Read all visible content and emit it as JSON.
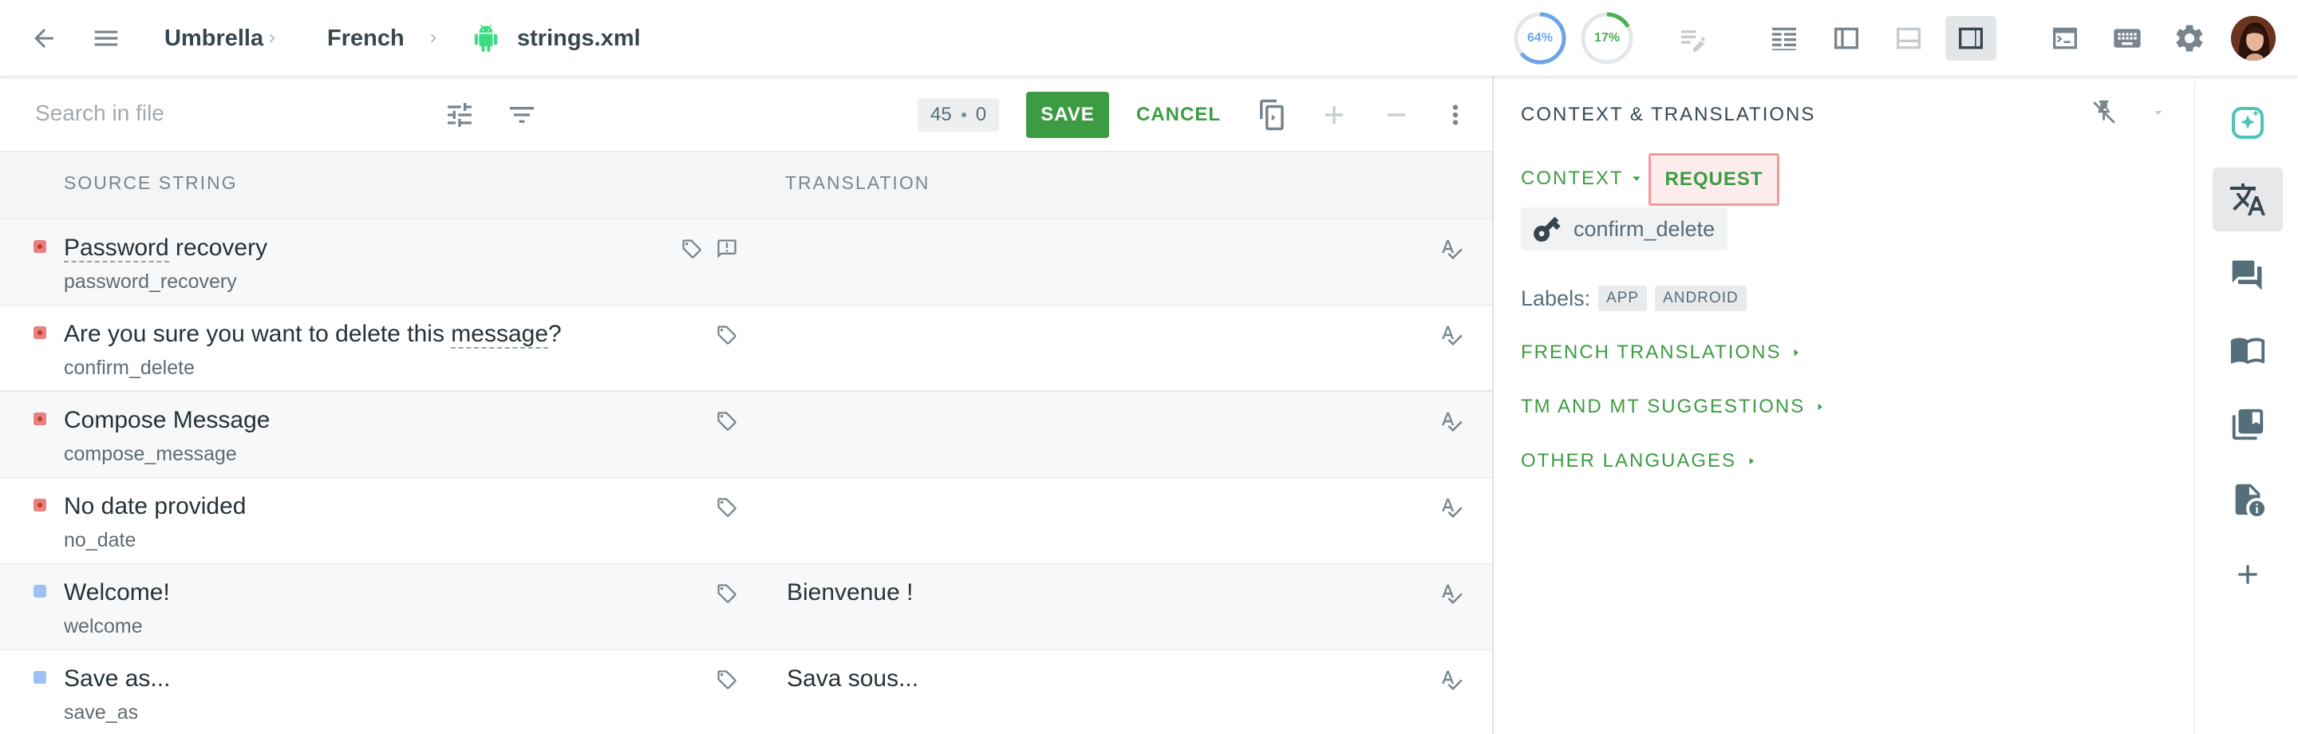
{
  "topbar": {
    "breadcrumb": [
      {
        "label": "Umbrella"
      },
      {
        "label": "French"
      },
      {
        "label": "strings.xml",
        "icon": "android-icon"
      }
    ],
    "progress": [
      {
        "label": "64%",
        "value": 64,
        "color": "#6aa5e8"
      },
      {
        "label": "17%",
        "value": 17,
        "color": "#4caf50"
      }
    ]
  },
  "editor": {
    "search_placeholder": "Search in file",
    "counter": {
      "left": "45",
      "right": "0"
    },
    "save_label": "SAVE",
    "cancel_label": "CANCEL"
  },
  "table": {
    "headers": {
      "source": "SOURCE STRING",
      "translation": "TRANSLATION"
    },
    "rows": [
      {
        "source_pre": "",
        "source_dashed": "Password",
        "source_post": " recovery",
        "key": "password_recovery",
        "translation": "",
        "status": "untranslated",
        "has_comment": true
      },
      {
        "source_pre": "Are you sure you want to delete this ",
        "source_dashed": "message",
        "source_post": "?",
        "key": "confirm_delete",
        "translation": "",
        "status": "untranslated",
        "has_comment": false
      },
      {
        "source_pre": "Compose Message",
        "source_dashed": "",
        "source_post": "",
        "key": "compose_message",
        "translation": "",
        "status": "untranslated",
        "has_comment": false
      },
      {
        "source_pre": "No date provided",
        "source_dashed": "",
        "source_post": "",
        "key": "no_date",
        "translation": "",
        "status": "untranslated",
        "has_comment": false
      },
      {
        "source_pre": "Welcome!",
        "source_dashed": "",
        "source_post": "",
        "key": "welcome",
        "translation": "Bienvenue !",
        "status": "translated",
        "has_comment": false
      },
      {
        "source_pre": "Save as...",
        "source_dashed": "",
        "source_post": "",
        "key": "save_as",
        "translation": "Sava sous...",
        "status": "translated",
        "has_comment": false
      }
    ]
  },
  "panel": {
    "title": "CONTEXT & TRANSLATIONS",
    "context_label": "CONTEXT",
    "request_label": "REQUEST",
    "key": "confirm_delete",
    "labels_title": "Labels:",
    "labels": [
      "APP",
      "ANDROID"
    ],
    "sections": [
      "FRENCH TRANSLATIONS",
      "TM AND MT SUGGESTIONS",
      "OTHER LANGUAGES"
    ]
  },
  "colors": {
    "accent": "#3d9c43",
    "untranslated": "#e88080",
    "translated": "#9ec0f5",
    "request_bg": "#fdecec"
  }
}
